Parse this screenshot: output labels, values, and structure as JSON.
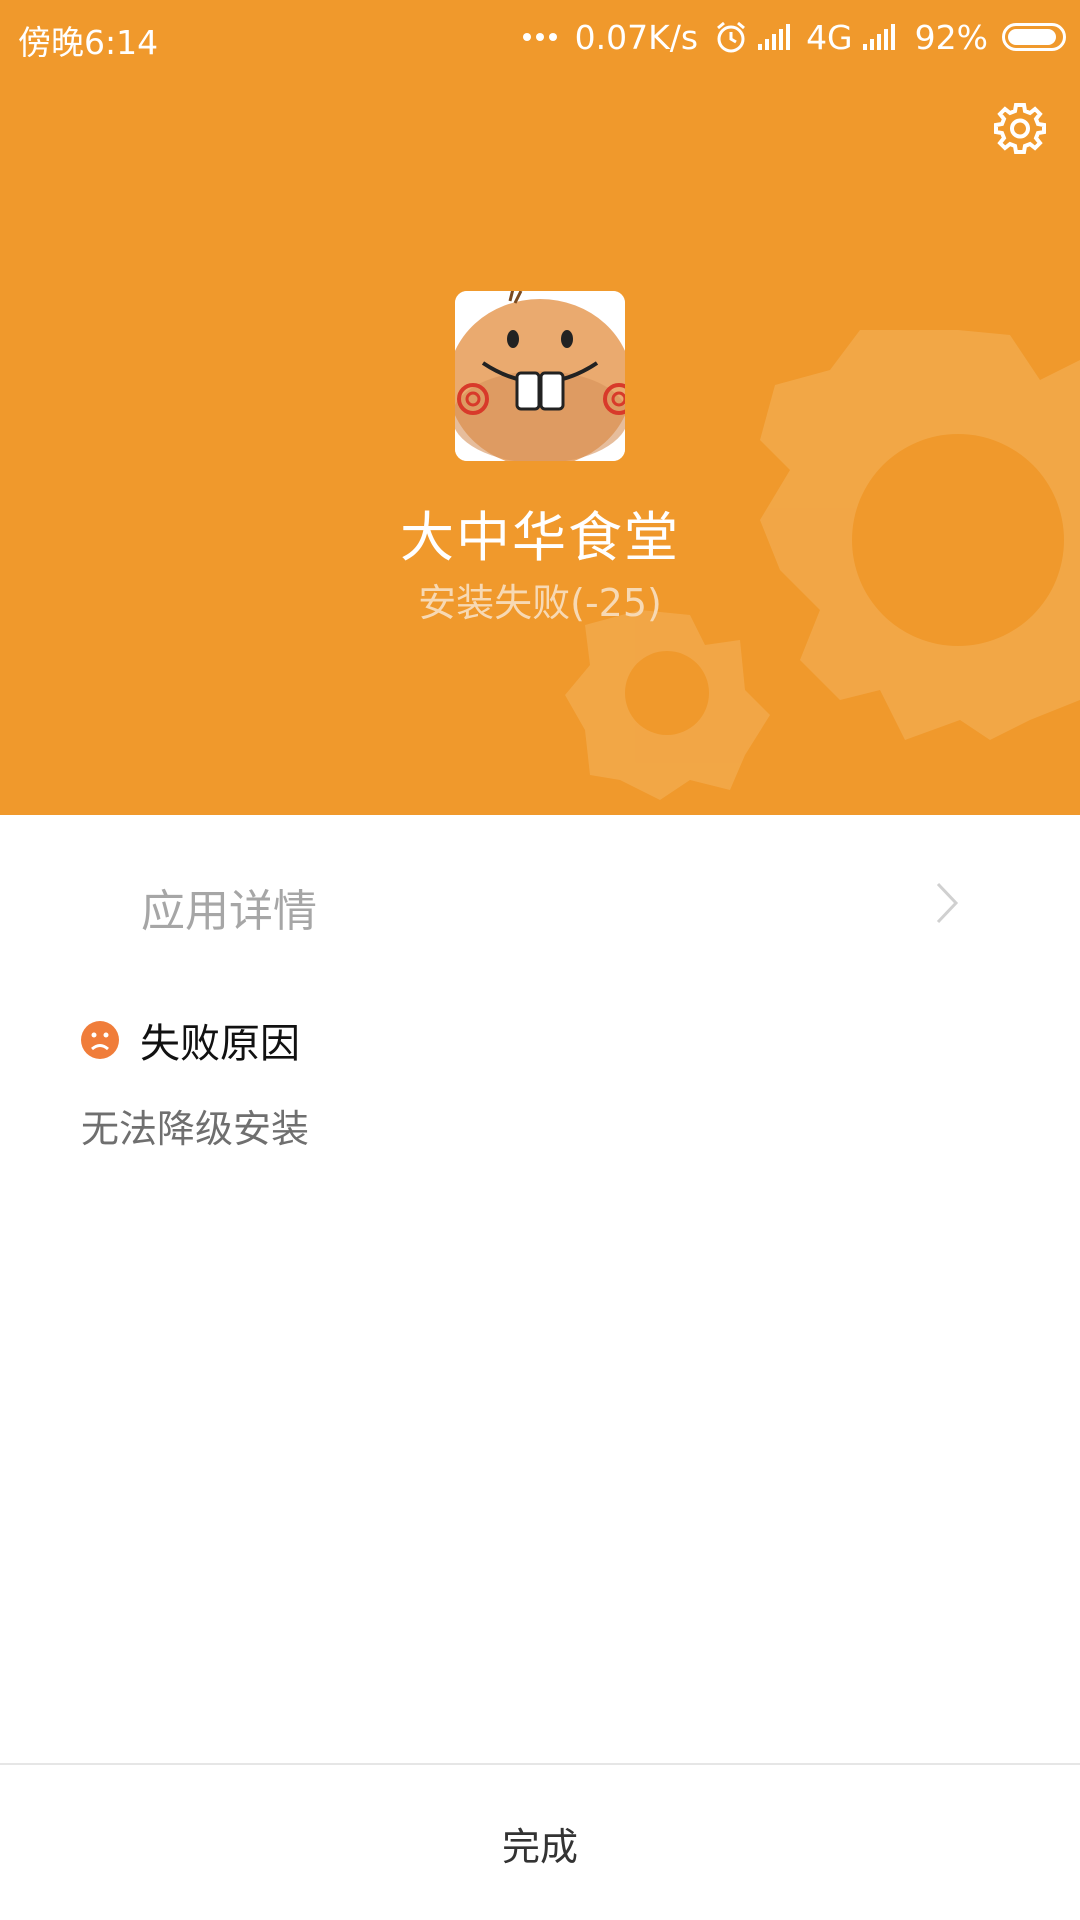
{
  "status_bar": {
    "time": "傍晚6:14",
    "net_speed": "0.07K/s",
    "network_type": "4G",
    "battery_percent": "92%",
    "icons": [
      "more-dots-icon",
      "alarm-icon",
      "signal-icon",
      "signal-icon",
      "battery-icon"
    ]
  },
  "header": {
    "background_color": "#f0992c",
    "settings_icon": "gear-icon",
    "app_name": "大中华食堂",
    "install_status": "安装失败(-25)"
  },
  "details": {
    "label": "应用详情",
    "chevron_icon": "chevron-right-icon"
  },
  "failure": {
    "title": "失败原因",
    "icon": "sad-face-icon",
    "icon_color": "#f07d3a",
    "reason": "无法降级安装"
  },
  "footer": {
    "done_label": "完成"
  }
}
